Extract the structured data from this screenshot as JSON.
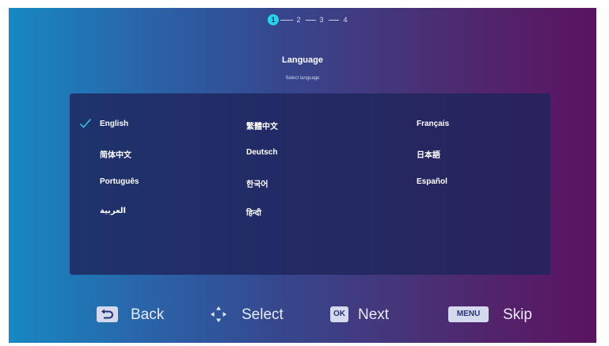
{
  "steps": [
    "1",
    "2",
    "3",
    "4"
  ],
  "header": {
    "title": "Language",
    "subtitle": "Select language"
  },
  "languages": [
    {
      "label": "English",
      "selected": true
    },
    {
      "label": "繁體中文"
    },
    {
      "label": "Français"
    },
    {
      "label": "简体中文"
    },
    {
      "label": "Deutsch"
    },
    {
      "label": "日本語"
    },
    {
      "label": "Português"
    },
    {
      "label": "한국어"
    },
    {
      "label": "Español"
    },
    {
      "label": "العربية"
    },
    {
      "label": "हिन्दी"
    }
  ],
  "footer": {
    "back": {
      "label": "Back"
    },
    "select": {
      "label": "Select"
    },
    "next": {
      "key": "OK",
      "label": "Next"
    },
    "skip": {
      "key": "MENU",
      "label": "Skip"
    }
  },
  "colors": {
    "accent": "#29d3ea",
    "check": "#3bc3ee",
    "panel": "#1e245c",
    "key_background": "#d5d9ee"
  }
}
